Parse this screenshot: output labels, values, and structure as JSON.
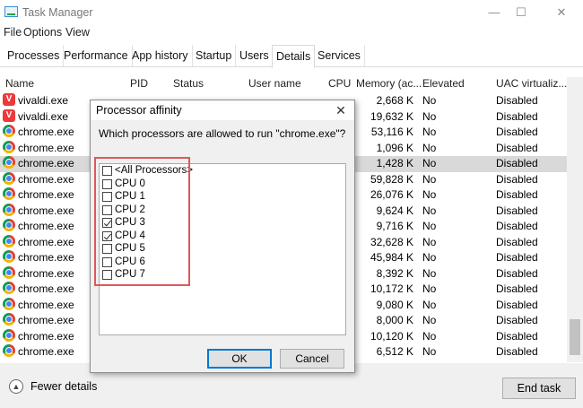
{
  "window": {
    "title": "Task Manager",
    "minimize": "—",
    "maximize": "☐",
    "close": "✕"
  },
  "menu": [
    "File",
    "Options",
    "View"
  ],
  "tabs": [
    "Processes",
    "Performance",
    "App history",
    "Startup",
    "Users",
    "Details",
    "Services"
  ],
  "active_tab": "Details",
  "columns": {
    "name": "Name",
    "pid": "PID",
    "status": "Status",
    "user": "User name",
    "cpu": "CPU",
    "memory": "Memory (ac...",
    "elevated": "Elevated",
    "uac": "UAC virtualiz..."
  },
  "rows": [
    {
      "name": "vivaldi.exe",
      "icon": "vivaldi-icon",
      "memory": "2,668 K",
      "elevated": "No",
      "uac": "Disabled"
    },
    {
      "name": "vivaldi.exe",
      "icon": "vivaldi-icon",
      "memory": "19,632 K",
      "elevated": "No",
      "uac": "Disabled"
    },
    {
      "name": "chrome.exe",
      "icon": "chrome-icon",
      "memory": "53,116 K",
      "elevated": "No",
      "uac": "Disabled"
    },
    {
      "name": "chrome.exe",
      "icon": "chrome-icon",
      "memory": "1,096 K",
      "elevated": "No",
      "uac": "Disabled"
    },
    {
      "name": "chrome.exe",
      "icon": "chrome-icon",
      "memory": "1,428 K",
      "elevated": "No",
      "uac": "Disabled",
      "selected": true
    },
    {
      "name": "chrome.exe",
      "icon": "chrome-icon",
      "memory": "59,828 K",
      "elevated": "No",
      "uac": "Disabled"
    },
    {
      "name": "chrome.exe",
      "icon": "chrome-icon",
      "memory": "26,076 K",
      "elevated": "No",
      "uac": "Disabled"
    },
    {
      "name": "chrome.exe",
      "icon": "chrome-icon",
      "memory": "9,624 K",
      "elevated": "No",
      "uac": "Disabled"
    },
    {
      "name": "chrome.exe",
      "icon": "chrome-icon",
      "memory": "9,716 K",
      "elevated": "No",
      "uac": "Disabled"
    },
    {
      "name": "chrome.exe",
      "icon": "chrome-icon",
      "memory": "32,628 K",
      "elevated": "No",
      "uac": "Disabled"
    },
    {
      "name": "chrome.exe",
      "icon": "chrome-icon",
      "memory": "45,984 K",
      "elevated": "No",
      "uac": "Disabled"
    },
    {
      "name": "chrome.exe",
      "icon": "chrome-icon",
      "memory": "8,392 K",
      "elevated": "No",
      "uac": "Disabled"
    },
    {
      "name": "chrome.exe",
      "icon": "chrome-icon",
      "memory": "10,172 K",
      "elevated": "No",
      "uac": "Disabled"
    },
    {
      "name": "chrome.exe",
      "icon": "chrome-icon",
      "memory": "9,080 K",
      "elevated": "No",
      "uac": "Disabled"
    },
    {
      "name": "chrome.exe",
      "icon": "chrome-icon",
      "memory": "8,000 K",
      "elevated": "No",
      "uac": "Disabled"
    },
    {
      "name": "chrome.exe",
      "icon": "chrome-icon",
      "memory": "10,120 K",
      "elevated": "No",
      "uac": "Disabled"
    },
    {
      "name": "chrome.exe",
      "icon": "chrome-icon",
      "memory": "6,512 K",
      "elevated": "No",
      "uac": "Disabled"
    }
  ],
  "footer": {
    "fewer_details": "Fewer details",
    "end_task": "End task",
    "fewer_icon": "chevron-up-icon"
  },
  "dialog": {
    "title": "Processor affinity",
    "question": "Which processors are allowed to run \"chrome.exe\"?",
    "processors": [
      {
        "label": "<All Processors>",
        "checked": false
      },
      {
        "label": "CPU 0",
        "checked": false
      },
      {
        "label": "CPU 1",
        "checked": false
      },
      {
        "label": "CPU 2",
        "checked": false
      },
      {
        "label": "CPU 3",
        "checked": true
      },
      {
        "label": "CPU 4",
        "checked": true
      },
      {
        "label": "CPU 5",
        "checked": false
      },
      {
        "label": "CPU 6",
        "checked": false
      },
      {
        "label": "CPU 7",
        "checked": false
      }
    ],
    "ok": "OK",
    "cancel": "Cancel",
    "close": "✕",
    "highlight_color": "#e05858"
  }
}
